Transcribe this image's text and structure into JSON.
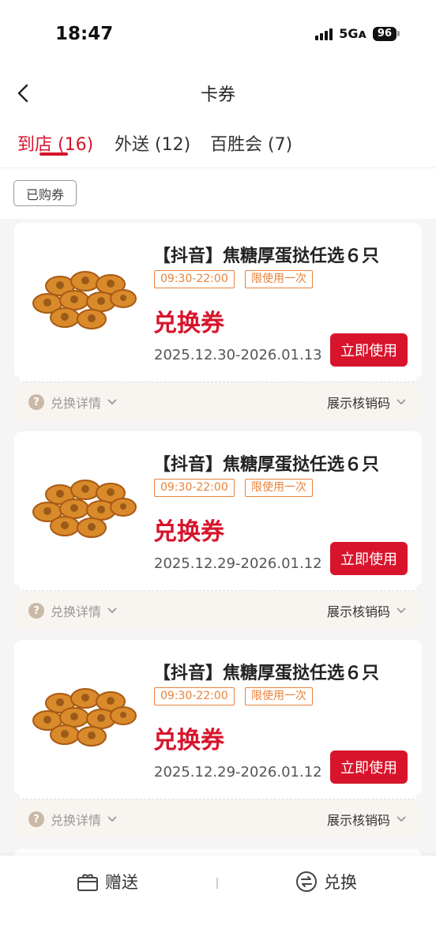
{
  "status_bar": {
    "time": "18:47",
    "network": "5Gᴀ",
    "battery": "96"
  },
  "header": {
    "title": "卡券"
  },
  "tabs": [
    {
      "label": "到店 (16)",
      "active": true
    },
    {
      "label": "外送 (12)",
      "active": false
    },
    {
      "label": "百胜会 (7)",
      "active": false
    }
  ],
  "filter": {
    "chip": "已购券"
  },
  "coupons": [
    {
      "title": "【抖音】焦糖厚蛋挞任选６只",
      "time_tag": "09:30-22:00",
      "limit_tag": "限使用一次",
      "type": "兑换券",
      "date": "2025.12.30-2026.01.13",
      "use_label": "立即使用",
      "detail_label": "兑换详情",
      "code_label": "展示核销码"
    },
    {
      "title": "【抖音】焦糖厚蛋挞任选６只",
      "time_tag": "09:30-22:00",
      "limit_tag": "限使用一次",
      "type": "兑换券",
      "date": "2025.12.29-2026.01.12",
      "use_label": "立即使用",
      "detail_label": "兑换详情",
      "code_label": "展示核销码"
    },
    {
      "title": "【抖音】焦糖厚蛋挞任选６只",
      "time_tag": "09:30-22:00",
      "limit_tag": "限使用一次",
      "type": "兑换券",
      "date": "2025.12.29-2026.01.12",
      "use_label": "立即使用",
      "detail_label": "兑换详情",
      "code_label": "展示核销码"
    }
  ],
  "bottom": {
    "gift_label": "赠送",
    "exchange_label": "兑换"
  },
  "colors": {
    "accent": "#d7142c",
    "tag": "#e9823a",
    "footer_bg": "#f8f5f1"
  }
}
